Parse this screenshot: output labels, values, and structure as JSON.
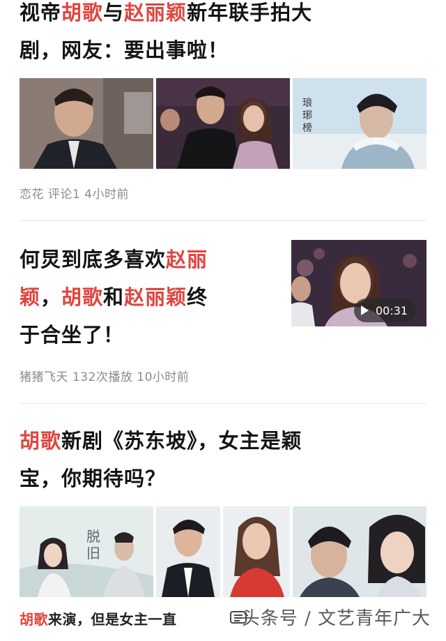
{
  "articles": [
    {
      "title_parts": [
        {
          "t": "视帝",
          "hl": false
        },
        {
          "t": "胡歌",
          "hl": true
        },
        {
          "t": "与",
          "hl": false
        },
        {
          "t": "赵丽颖",
          "hl": true
        },
        {
          "t": "新年联手拍大",
          "hl": false
        }
      ],
      "title_line2": "剧，网友：要出事啦！",
      "meta": "恋花  评论1  4小时前"
    },
    {
      "title_line1_parts": [
        {
          "t": "何炅到底多喜欢",
          "hl": false
        },
        {
          "t": "赵丽",
          "hl": true
        }
      ],
      "title_line2_parts": [
        {
          "t": "颖",
          "hl": true
        },
        {
          "t": "，",
          "hl": false
        },
        {
          "t": "胡歌",
          "hl": true
        },
        {
          "t": "和",
          "hl": false
        },
        {
          "t": "赵丽颖",
          "hl": true
        },
        {
          "t": "终",
          "hl": false
        }
      ],
      "title_line3": "于合坐了！",
      "duration": "00:31",
      "meta": "猪猪飞天  132次播放  10小时前"
    },
    {
      "title_line1_parts": [
        {
          "t": "胡歌",
          "hl": true
        },
        {
          "t": "新剧《苏东坡》，女主是颖",
          "hl": false
        }
      ],
      "title_line2": "宝，你期待吗？",
      "snippet_parts": [
        {
          "t": "胡歌",
          "hl": true
        },
        {
          "t": "来演，但是女主一直",
          "hl": false
        }
      ]
    }
  ],
  "watermark": "头条号 / 文艺青年广大",
  "colors": {
    "highlight": "#e0453f",
    "meta": "#8a8a8a",
    "divider": "#e6e6e6"
  }
}
